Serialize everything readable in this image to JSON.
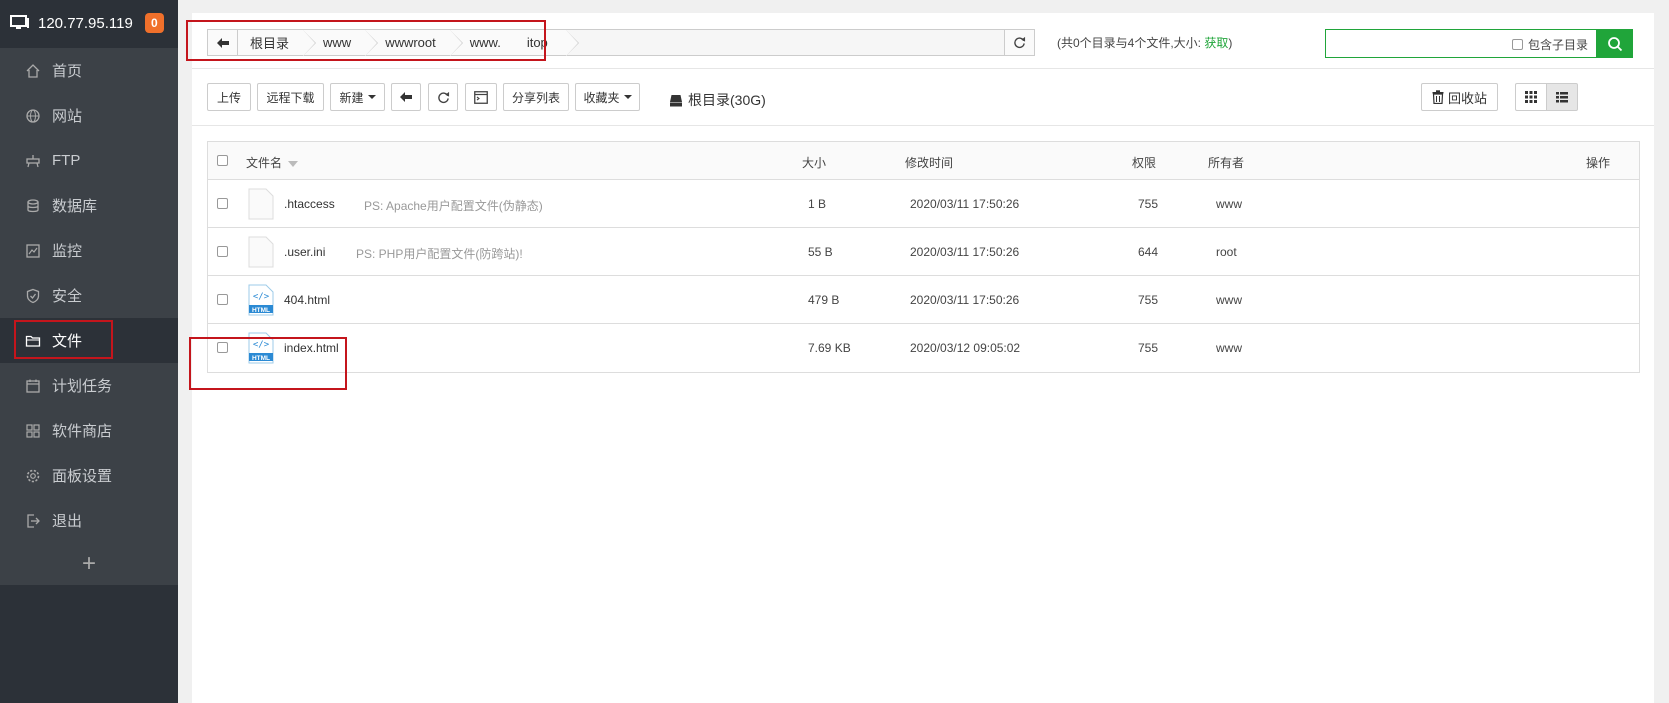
{
  "sidebar": {
    "server_ip": "120.77.95.119",
    "badge": "0",
    "items": [
      {
        "label": "首页",
        "icon": "home-icon"
      },
      {
        "label": "网站",
        "icon": "globe-icon"
      },
      {
        "label": "FTP",
        "icon": "ftp-icon"
      },
      {
        "label": "数据库",
        "icon": "database-icon"
      },
      {
        "label": "监控",
        "icon": "monitor-icon"
      },
      {
        "label": "安全",
        "icon": "shield-icon"
      },
      {
        "label": "文件",
        "icon": "folder-icon",
        "active": true
      },
      {
        "label": "计划任务",
        "icon": "calendar-icon"
      },
      {
        "label": "软件商店",
        "icon": "apps-icon"
      },
      {
        "label": "面板设置",
        "icon": "gear-icon"
      },
      {
        "label": "退出",
        "icon": "logout-icon"
      }
    ],
    "add_label": "+"
  },
  "path": {
    "crumbs": [
      "根目录",
      "www",
      "wwwroot",
      "www.  itop"
    ]
  },
  "stats": {
    "text": "(共0个目录与4个文件,大小:",
    "get_label": "获取",
    "close": ")"
  },
  "search": {
    "placeholder": "",
    "subdir_label": "包含子目录"
  },
  "toolbar": {
    "upload": "上传",
    "remote_download": "远程下载",
    "new": "新建",
    "share_list": "分享列表",
    "favorites": "收藏夹",
    "disk_label": "根目录(30G)",
    "recycle_bin": "回收站"
  },
  "table": {
    "headers": {
      "name": "文件名",
      "size": "大小",
      "mtime": "修改时间",
      "perm": "权限",
      "owner": "所有者",
      "ops": "操作"
    },
    "rows": [
      {
        "name": ".htaccess",
        "ps": "PS: Apache用户配置文件(伪静态)",
        "size": "1 B",
        "mtime": "2020/03/11 17:50:26",
        "perm": "755",
        "owner": "www",
        "type": "blank"
      },
      {
        "name": ".user.ini",
        "ps": "PS: PHP用户配置文件(防跨站)!",
        "size": "55 B",
        "mtime": "2020/03/11 17:50:26",
        "perm": "644",
        "owner": "root",
        "type": "blank"
      },
      {
        "name": "404.html",
        "ps": "",
        "size": "479 B",
        "mtime": "2020/03/11 17:50:26",
        "perm": "755",
        "owner": "www",
        "type": "html"
      },
      {
        "name": "index.html",
        "ps": "",
        "size": "7.69 KB",
        "mtime": "2020/03/12 09:05:02",
        "perm": "755",
        "owner": "www",
        "type": "html"
      }
    ],
    "html_tag": "HTML"
  },
  "colors": {
    "accent": "#20a53a",
    "sidebar": "#3c4147",
    "highlight": "#c4151c"
  }
}
